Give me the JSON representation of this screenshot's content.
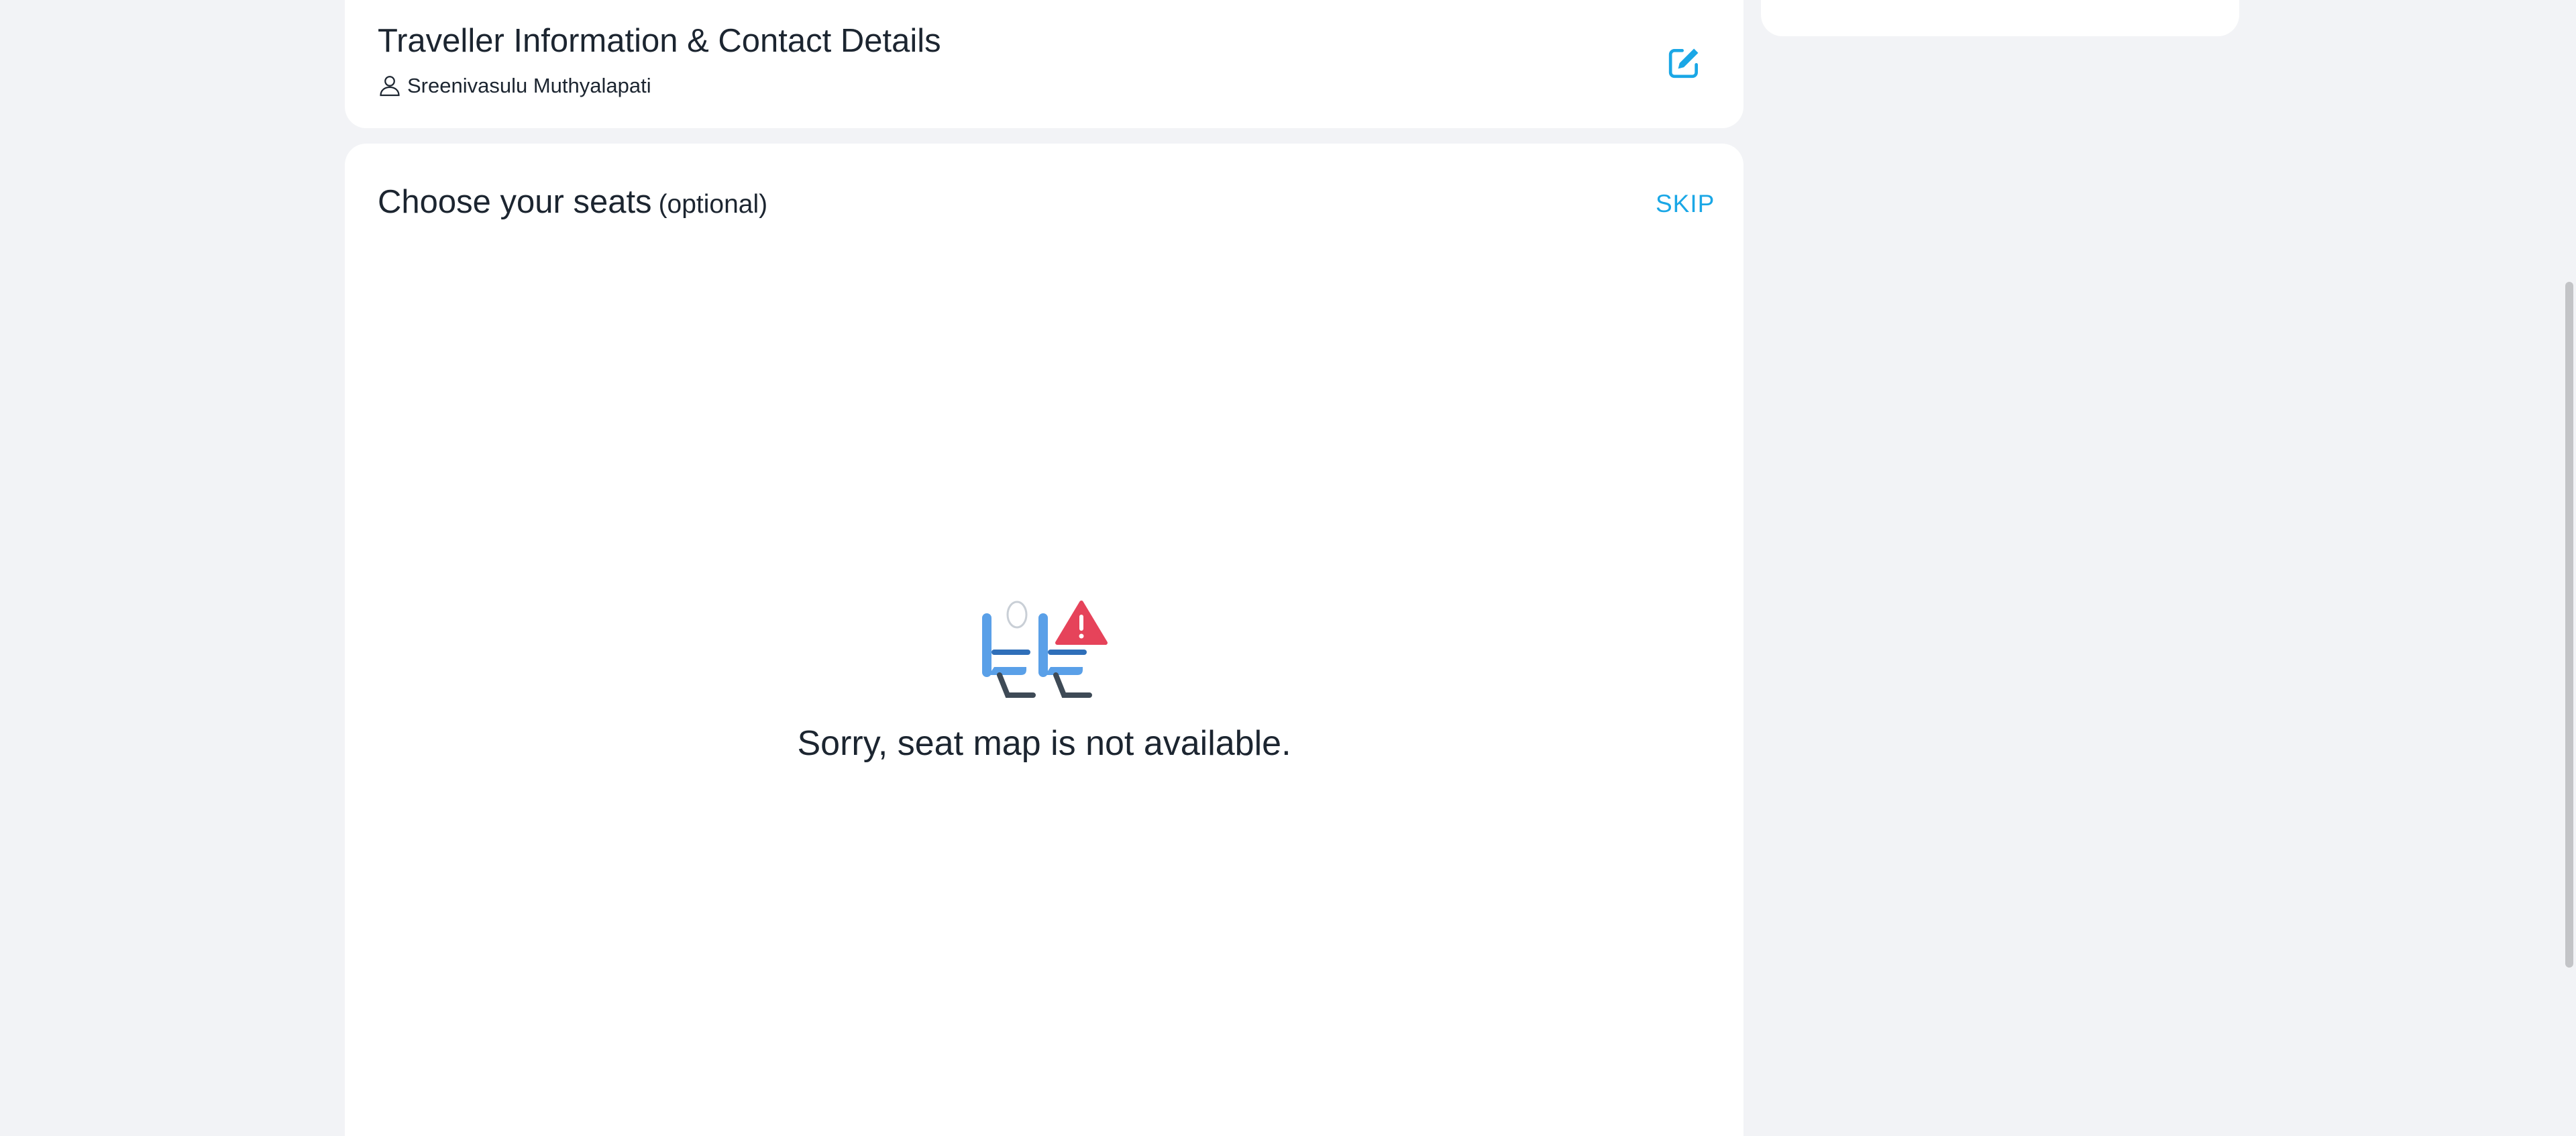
{
  "traveller": {
    "title": "Traveller Information & Contact Details",
    "name": "Sreenivasulu Muthyalapati",
    "user_icon": "user-icon",
    "edit_icon": "edit-icon"
  },
  "seats": {
    "title": "Choose your seats",
    "optional_label": "(optional)",
    "skip_label": "SKIP",
    "illustration_icon": "seat-warning-icon",
    "empty_message": "Sorry, seat map is not available."
  },
  "colors": {
    "accent": "#1aa7e6",
    "background": "#f2f3f6",
    "card": "#ffffff",
    "warning": "#e6435a",
    "seat_blue": "#5aa0e8",
    "seat_dark": "#3e4a56"
  }
}
